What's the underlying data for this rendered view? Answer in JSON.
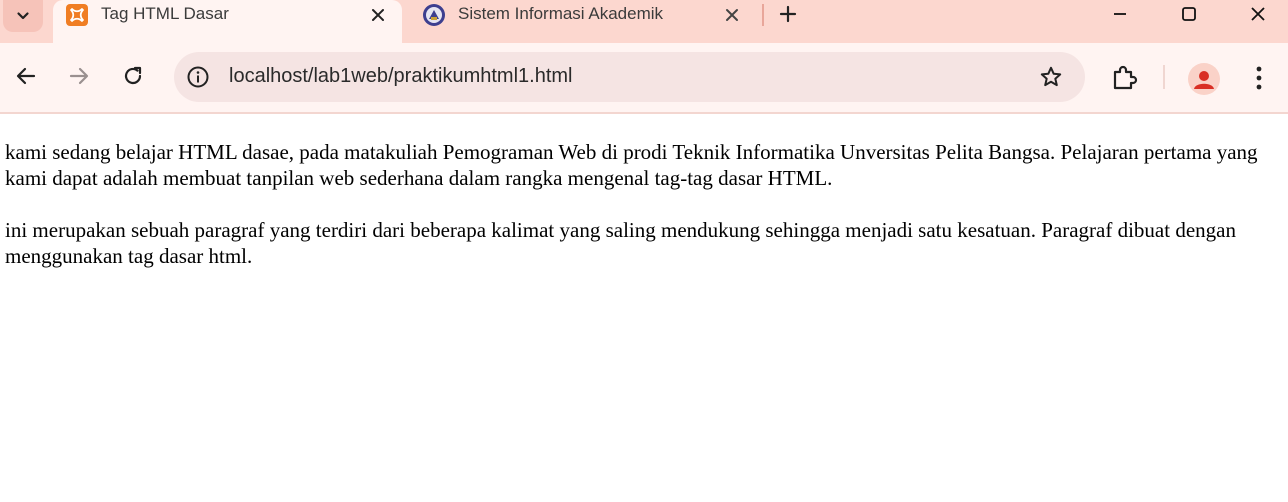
{
  "browser": {
    "tabs": [
      {
        "title": "Tag HTML Dasar",
        "active": true,
        "favicon": "xampp-icon"
      },
      {
        "title": "Sistem Informasi Akademik",
        "active": false,
        "favicon": "university-crest-icon"
      }
    ],
    "address": {
      "url": "localhost/lab1web/praktikumhtml1.html"
    },
    "colors": {
      "tabstrip": "#fcd7cf",
      "toolbar": "#fff4f2",
      "omnibox": "#f5e4e3",
      "favicon_orange": "#f07d23",
      "avatar_red": "#d93025"
    }
  },
  "page": {
    "paragraphs": [
      "kami sedang belajar HTML dasae, pada matakuliah Pemograman Web di prodi Teknik Informatika Unversitas Pelita Bangsa. Pelajaran pertama yang kami dapat adalah membuat tanpilan web sederhana dalam rangka mengenal tag-tag dasar HTML.",
      "ini merupakan sebuah paragraf yang terdiri dari beberapa kalimat yang saling mendukung sehingga menjadi satu kesatuan. Paragraf dibuat dengan menggunakan tag dasar html."
    ]
  }
}
